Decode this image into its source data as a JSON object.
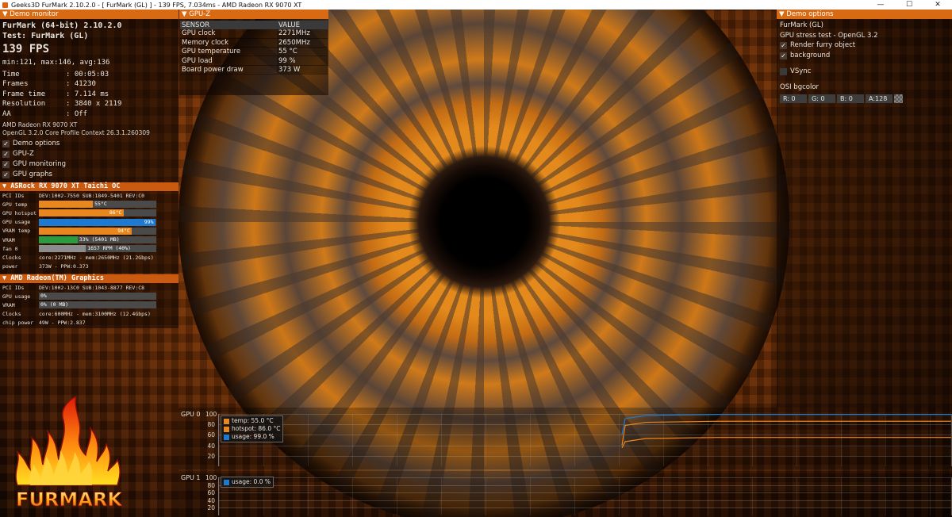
{
  "window": {
    "title": "Geeks3D FurMark 2.10.2.0 - [ FurMark (GL) ] - 139 FPS, 7.034ms - AMD Radeon RX 9070 XT"
  },
  "demo_monitor": {
    "header": "Demo monitor",
    "line1": "FurMark (64-bit) 2.10.2.0",
    "line2": "Test: FurMark (GL)",
    "fps": "139 FPS",
    "minmax": "min:121, max:146, avg:136",
    "stats": [
      {
        "k": "Time",
        "v": ":  00:05:03"
      },
      {
        "k": "Frames",
        "v": ":  41230"
      },
      {
        "k": "Frame time",
        "v": ":  7.114 ms"
      },
      {
        "k": "Resolution",
        "v": ":  3840 x 2119"
      },
      {
        "k": "AA",
        "v": ":  Off"
      }
    ],
    "gpu_name": "AMD Radeon RX 9070 XT",
    "opengl": "OpenGL 3.2.0 Core Profile Context 26.3.1.260309",
    "checks": [
      {
        "label": "Demo options",
        "checked": true
      },
      {
        "label": "GPU-Z",
        "checked": true
      },
      {
        "label": "GPU monitoring",
        "checked": true
      },
      {
        "label": "GPU graphs",
        "checked": true
      }
    ]
  },
  "gpu1_section": {
    "header": "ASRock RX 9070 XT Taichi OC",
    "pci_label": "PCI IDs",
    "pci": "DEV:1002-7550 SUB:1849-5401 REV:C0",
    "bars": [
      {
        "label": "GPU temp",
        "text": "55°C",
        "pct": 0.46,
        "color": "#e8871e"
      },
      {
        "label": "GPU hotspot",
        "text": "86°C",
        "pct": 0.72,
        "color": "#e8871e"
      },
      {
        "label": "GPU usage",
        "text": "99%",
        "pct": 0.99,
        "color": "#1e7ad0"
      },
      {
        "label": "VRAM temp",
        "text": "94°C",
        "pct": 0.79,
        "color": "#e8871e"
      },
      {
        "label": "VRAM",
        "text": "33% (5401 MB)",
        "pct": 0.33,
        "color": "#2e9a3e"
      },
      {
        "label": "fan 0",
        "text": "1657 RPM (40%)",
        "pct": 0.4,
        "color": "#8c8c8c"
      }
    ],
    "clocks_label": "Clocks",
    "clocks": "core:2271MHz - mem:2650MHz (21.2Gbps)",
    "power_label": "power",
    "power": "373W - PPW:0.373"
  },
  "gpu2_section": {
    "header": "AMD Radeon(TM) Graphics",
    "pci_label": "PCI IDs",
    "pci": "DEV:1002-13C0 SUB:1043-8877 REV:C8",
    "bars": [
      {
        "label": "GPU usage",
        "text": "0%",
        "pct": 0.0,
        "color": "#1e7ad0"
      },
      {
        "label": "VRAM",
        "text": "0% (0 MB)",
        "pct": 0.0,
        "color": "#2e9a3e"
      }
    ],
    "clocks_label": "Clocks",
    "clocks": "core:600MHz - mem:3100MHz (12.4Gbps)",
    "power_label": "chip power",
    "power": "49W - PPW:2.837"
  },
  "gpuz": {
    "header": "GPU-Z",
    "columns": [
      "SENSOR",
      "VALUE"
    ],
    "rows": [
      [
        "GPU clock",
        "2271MHz"
      ],
      [
        "Memory clock",
        "2650MHz"
      ],
      [
        "GPU temperature",
        "55 °C"
      ],
      [
        "GPU load",
        "99 %"
      ],
      [
        "Board power draw",
        "373 W"
      ]
    ]
  },
  "demo_options": {
    "header": "Demo options",
    "name": "FurMark (GL)",
    "desc": "GPU stress test - OpenGL 3.2",
    "render_furry": "Render furry object",
    "background": "background",
    "vsync": "VSync",
    "osi_label": "OSI bgcolor",
    "r": "R: 0",
    "g": "G: 0",
    "b": "B: 0",
    "a": "A:128"
  },
  "graphs": {
    "gpu0": {
      "title": "GPU 0",
      "yticks": [
        "100",
        "80",
        "60",
        "40",
        "20"
      ],
      "legend": [
        {
          "label": "temp: 55.0 °C",
          "color": "#e8871e"
        },
        {
          "label": "hotspot: 86.0 °C",
          "color": "#e8871e"
        },
        {
          "label": "usage: 99.0 %",
          "color": "#1e7ad0"
        }
      ]
    },
    "gpu1": {
      "title": "GPU 1",
      "yticks": [
        "100",
        "80",
        "60",
        "40",
        "20"
      ],
      "legend": [
        {
          "label": "usage: 0.0 %",
          "color": "#1e7ad0"
        }
      ]
    }
  },
  "logo": {
    "text": "FURMARK"
  }
}
